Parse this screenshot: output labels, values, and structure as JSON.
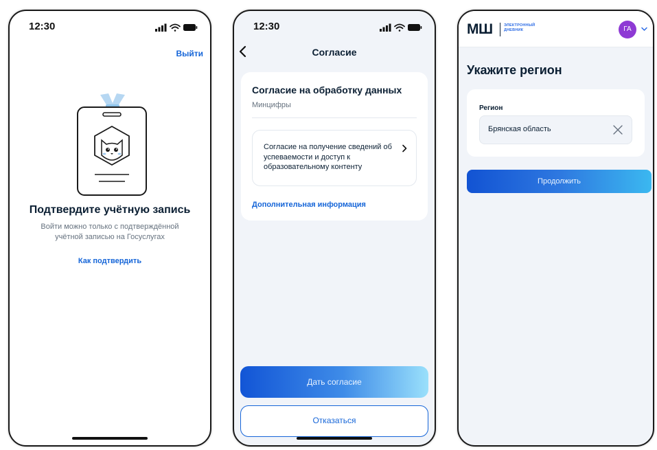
{
  "screen1": {
    "time": "12:30",
    "logout_label": "Выйти",
    "title": "Подтвердите учётную запись",
    "subtitle": "Войти можно только с подтверждённой учётной записью на Госуслугах",
    "link_label": "Как подтвердить"
  },
  "screen2": {
    "time": "12:30",
    "header": "Согласие",
    "card_title": "Согласие на обработку данных",
    "card_subtitle": "Минцифры",
    "consent_item": "Согласие на получение сведений об успеваемости и доступ к образовательному контенту",
    "more_info_link": "Дополнительная информация",
    "agree_button": "Дать согласие",
    "decline_button": "Отказаться"
  },
  "screen3": {
    "logo_mark": "МШ",
    "logo_text_line1": "ЭЛЕКТРОННЫЙ",
    "logo_text_line2": "ДНЕВНИК",
    "avatar_initials": "ГА",
    "title": "Укажите регион",
    "region_label": "Регион",
    "region_value": "Брянская область",
    "continue_button": "Продолжить"
  },
  "colors": {
    "accent": "#1565d8",
    "avatar": "#8e3ad4",
    "text": "#0b1f33",
    "muted": "#66727f"
  },
  "icons": [
    "signal-icon",
    "wifi-icon",
    "battery-icon",
    "back-arrow-icon",
    "chevron-right-icon",
    "close-icon",
    "chevron-down-icon",
    "badge-cat-illustration"
  ]
}
